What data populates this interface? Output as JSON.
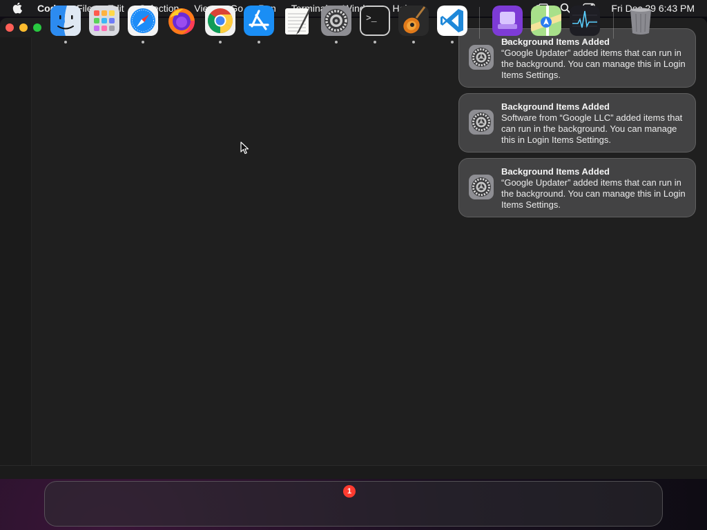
{
  "menubar": {
    "app_name": "Code",
    "items": [
      "File",
      "Edit",
      "Selection",
      "View",
      "Go",
      "Run",
      "Terminal",
      "Window",
      "Help"
    ],
    "clock": "Fri Dec 29  6:43 PM",
    "status_icons": [
      "screen-mirroring-icon",
      "spotlight-search-icon",
      "control-center-icon"
    ]
  },
  "notifications": [
    {
      "title": "Background Items Added",
      "body": "“Google Updater” added items that can run in the background. You can manage this in Login Items Settings.",
      "icon": "system-settings-gear-icon"
    },
    {
      "title": "Background Items Added",
      "body": "Software from “Google LLC” added items that can run in the background. You can manage this in Login Items Settings.",
      "icon": "system-settings-gear-icon"
    },
    {
      "title": "Background Items Added",
      "body": "“Google Updater” added items that can run in the background. You can manage this in Login Items Settings.",
      "icon": "system-settings-gear-icon"
    }
  ],
  "dock": {
    "apps": [
      "finder",
      "launchpad",
      "safari",
      "firefox",
      "chrome",
      "app-store",
      "textedit",
      "system-settings",
      "terminal",
      "garageband",
      "vscode",
      "apple-configurator",
      "maps",
      "activity-monitor",
      "trash"
    ],
    "system_settings_badge": "1"
  },
  "colors": {
    "menubar": "#1c1c1e",
    "window": "#1f1f1f",
    "notification": "#464648",
    "close": "#ff5f57",
    "minimize": "#febc2e",
    "zoom": "#28c840",
    "badge": "#ff3b30"
  }
}
